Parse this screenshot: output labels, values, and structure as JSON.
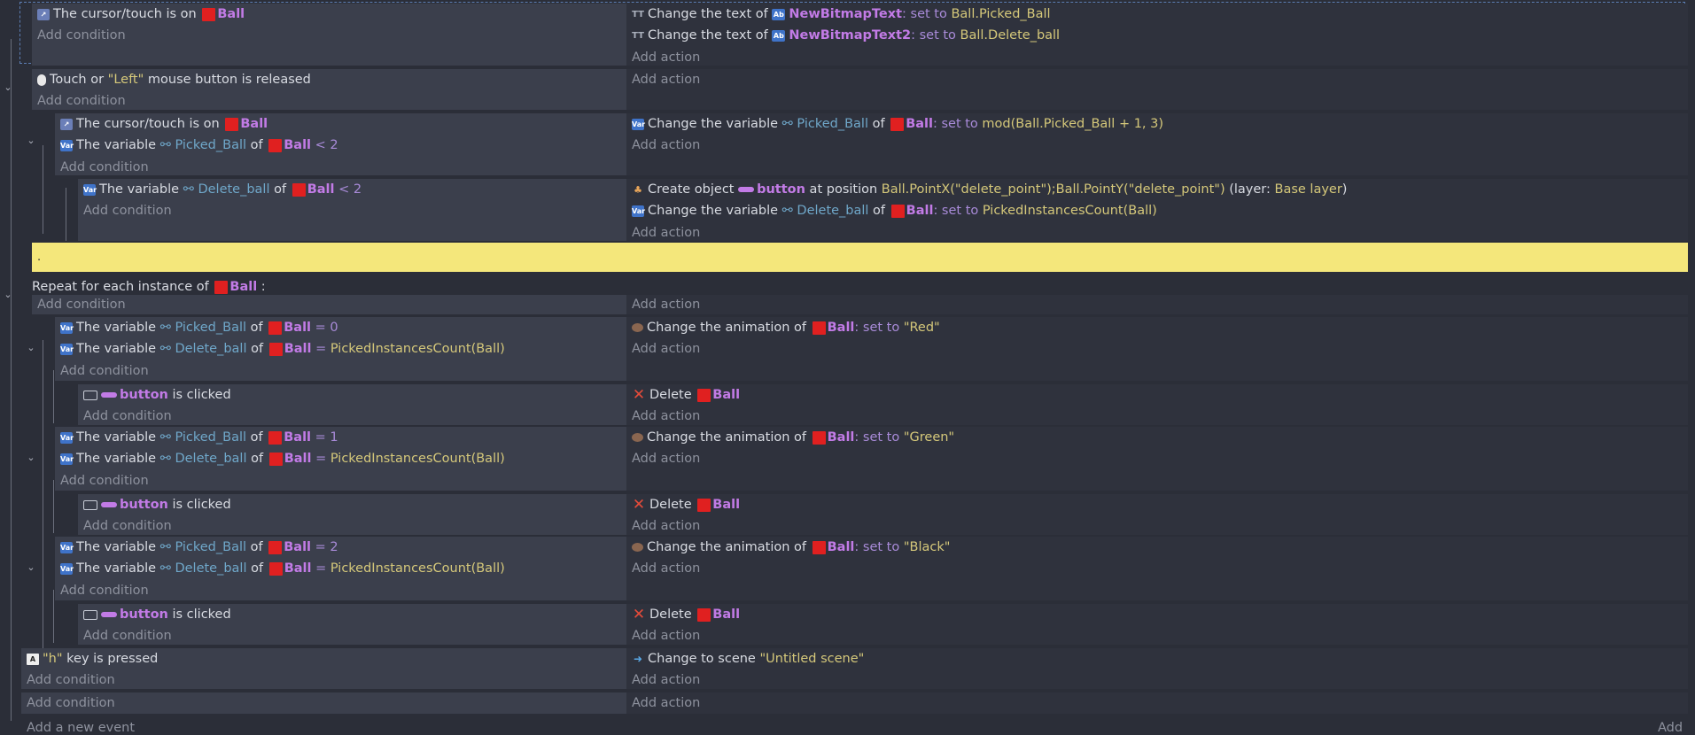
{
  "labels": {
    "add_condition": "Add condition",
    "add_action": "Add action",
    "add_new_event": "Add a new event",
    "add_right": "Add",
    "comment_text": ".",
    "repeat_prefix": "Repeat for each instance of ",
    "repeat_suffix": " :"
  },
  "objects": {
    "ball": "Ball",
    "button": "button",
    "bitmap1": "NewBitmapText",
    "bitmap2": "NewBitmapText2"
  },
  "variables": {
    "picked": "Picked_Ball",
    "delete": "Delete_ball"
  },
  "words": {
    "the_cursor_touch_is_on": "The cursor/touch is on ",
    "the_variable": "The variable ",
    "of": " of ",
    "change_text_of": "Change the text of ",
    "change_variable": "Change the variable ",
    "change_animation_of": "Change the animation of ",
    "create_object": "Create object ",
    "at_position": " at position ",
    "delete": "Delete ",
    "is_clicked": " is clicked",
    "set_to": ": set to ",
    "touch_or": "Touch or ",
    "left_str": "\"Left\"",
    "mouse_released": " mouse button is released",
    "h_str": "\"h\"",
    "key_pressed": " key is pressed",
    "change_to_scene": "Change to scene ",
    "scene_name": "\"Untitled scene\"",
    "layer_prefix": " (layer: ",
    "layer_name": "Base layer",
    "layer_suffix": ")",
    "lt2": "< 2",
    "eq0": "= 0",
    "eq1": "= 1",
    "eq2": "= 2",
    "eq_pic": "= ",
    "picked_instances": "PickedInstancesCount(Ball)",
    "ball_picked": "Ball.Picked_Ball",
    "ball_delete": "Ball.Delete_ball",
    "mod_expr": "mod(Ball.Picked_Ball + 1, 3)",
    "position_expr": "Ball.PointX(\"delete_point\");Ball.PointY(\"delete_point\")",
    "red": "\"Red\"",
    "green": "\"Green\"",
    "black": "\"Black\""
  },
  "colors": {
    "object": "#c27be6",
    "string": "#d5c87a",
    "keyword": "#a98bd9",
    "variable": "#6fa7c9",
    "comment_bg": "#f4e77b",
    "ball_swatch": "#e02020"
  }
}
